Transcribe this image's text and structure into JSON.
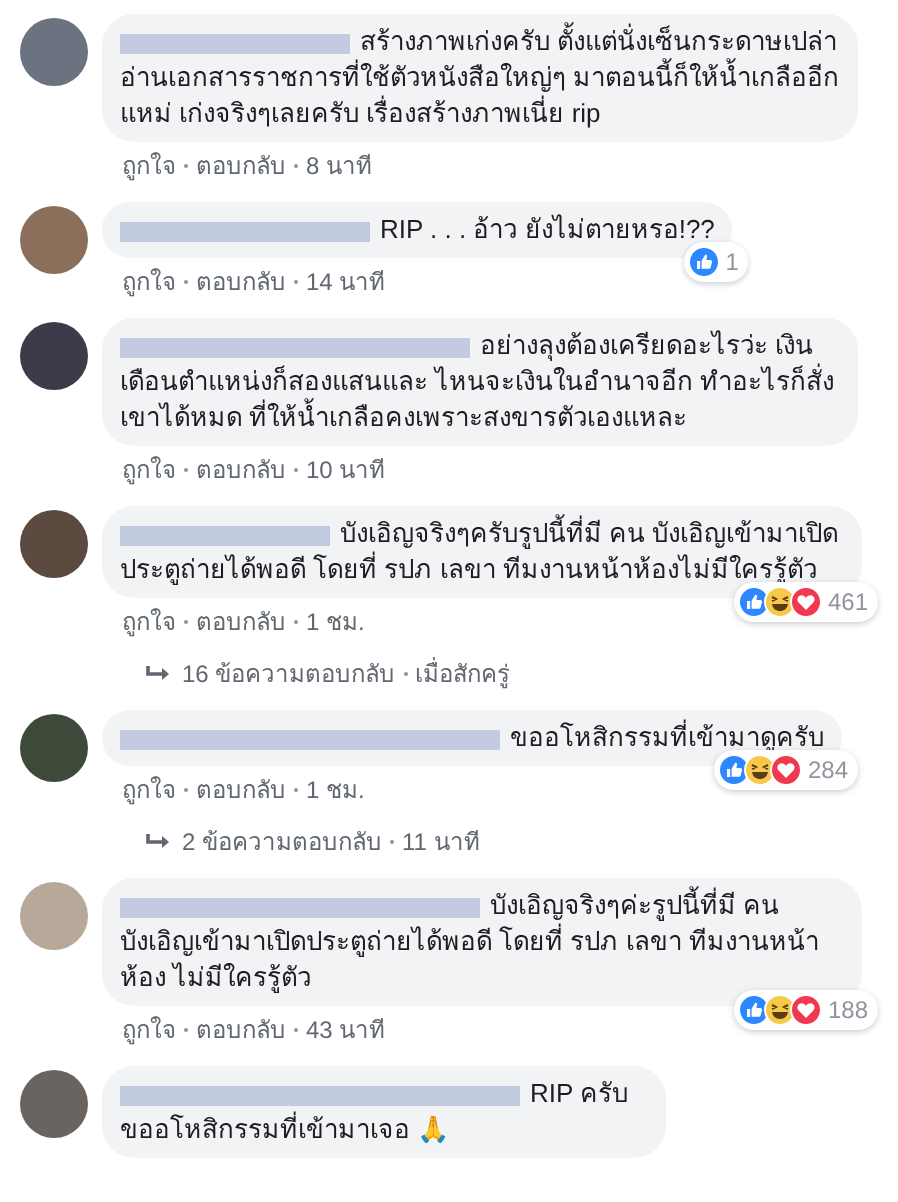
{
  "comments": [
    {
      "text": "สร้างภาพเก่งครับ ตั้งแต่นั่งเซ็นกระดาษเปล่า อ่านเอกสารราชการที่ใช้ตัวหนังสือใหญ่ๆ มาตอนนี้ก็ให้น้ำเกลืออีก แหม่ เก่งจริงๆเลยครับ เรื่องสร้างภาพเนี่ย rip",
      "like": "ถูกใจ",
      "reply": "ตอบกลับ",
      "time": "8 นาที"
    },
    {
      "text": "RIP . . . อ้าว ยังไม่ตายหรอ!??",
      "like": "ถูกใจ",
      "reply": "ตอบกลับ",
      "time": "14 นาที",
      "reactions": {
        "icons": [
          {
            "kind": "like"
          }
        ],
        "count": "1"
      }
    },
    {
      "text": "อย่างลุงต้องเครียดอะไรว่ะ เงินเดือนตำแหน่งก็สองแสนและ ไหนจะเงินในอำนาจอีก ทำอะไรก็สั่งเขาได้หมด ที่ให้น้ำเกลือคงเพราะสงขารตัวเองแหละ",
      "like": "ถูกใจ",
      "reply": "ตอบกลับ",
      "time": "10 นาที"
    },
    {
      "text": "บังเอิญจริงๆครับรูปนี้ที่มี คน บังเอิญเข้ามาเปิดประตูถ่ายได้พอดี โดยที่ รปภ เลขา ทีมงานหน้าห้องไม่มีใครรู้ตัว",
      "like": "ถูกใจ",
      "reply": "ตอบกลับ",
      "time": "1 ชม.",
      "reactions": {
        "icons": [
          {
            "kind": "like"
          },
          {
            "kind": "haha"
          },
          {
            "kind": "love"
          }
        ],
        "count": "461"
      },
      "replies": {
        "label": "16 ข้อความตอบกลับ",
        "time": "เมื่อสักครู่"
      }
    },
    {
      "text": "ขออโหสิกรรมที่เข้ามาดูครับ",
      "like": "ถูกใจ",
      "reply": "ตอบกลับ",
      "time": "1 ชม.",
      "reactions": {
        "icons": [
          {
            "kind": "like"
          },
          {
            "kind": "haha"
          },
          {
            "kind": "love"
          }
        ],
        "count": "284"
      },
      "replies": {
        "label": "2 ข้อความตอบกลับ",
        "time": "11 นาที"
      }
    },
    {
      "text": "บังเอิญจริงๆค่ะรูปนี้ที่มี คน บังเอิญเข้ามาเปิดประตูถ่ายได้พอดี โดยที่ รปภ เลขา ทีมงานหน้าห้อง ไม่มีใครรู้ตัว",
      "like": "ถูกใจ",
      "reply": "ตอบกลับ",
      "time": "43 นาที",
      "reactions": {
        "icons": [
          {
            "kind": "like"
          },
          {
            "kind": "haha"
          },
          {
            "kind": "love"
          }
        ],
        "count": "188"
      }
    },
    {
      "text": "RIP ครับ ขออโหสิกรรมที่เข้ามาเจอ 🙏"
    }
  ]
}
